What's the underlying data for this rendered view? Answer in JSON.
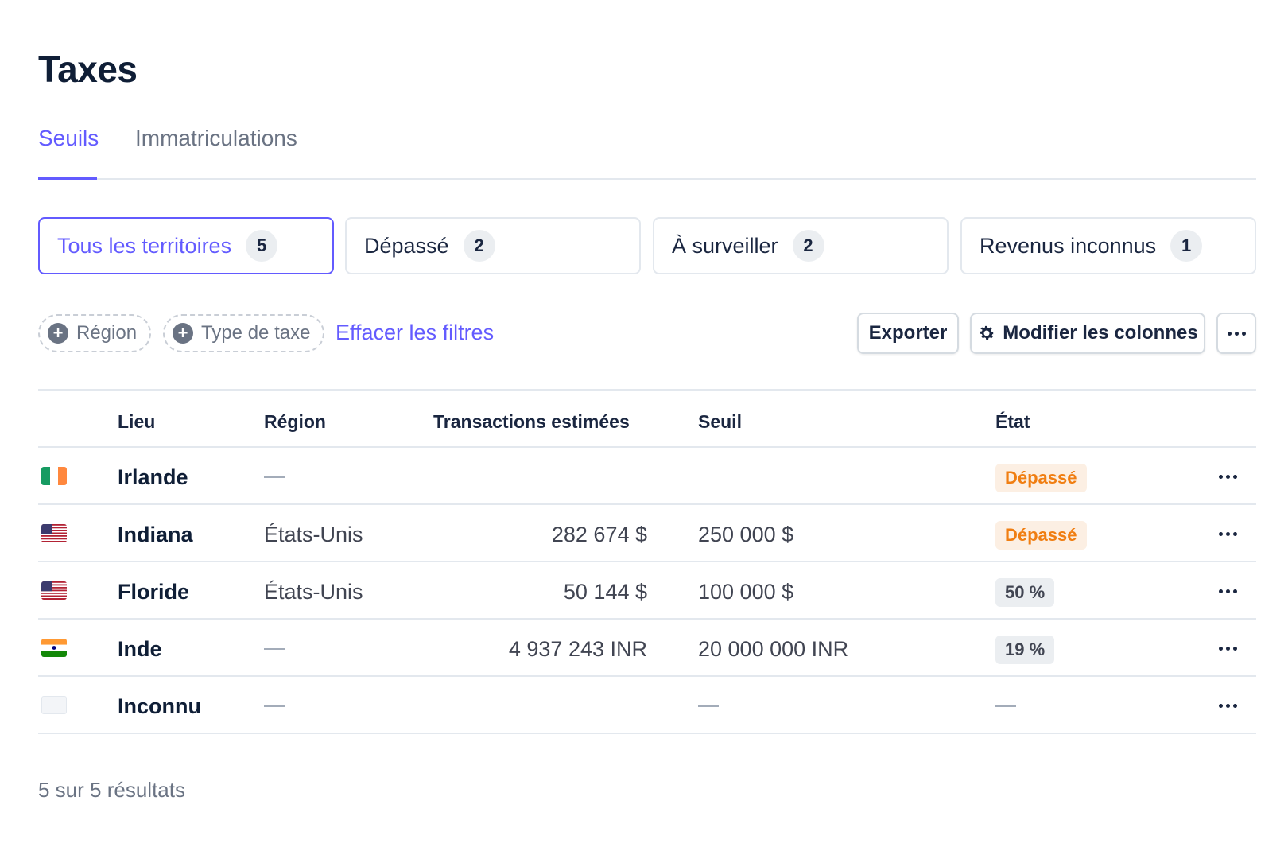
{
  "page": {
    "title": "Taxes"
  },
  "tabs": [
    {
      "label": "Seuils",
      "active": true
    },
    {
      "label": "Immatriculations",
      "active": false
    }
  ],
  "filter_cards": [
    {
      "label": "Tous les territoires",
      "count": "5",
      "selected": true
    },
    {
      "label": "Dépassé",
      "count": "2",
      "selected": false
    },
    {
      "label": "À surveiller",
      "count": "2",
      "selected": false
    },
    {
      "label": "Revenus inconnus",
      "count": "1",
      "selected": false
    }
  ],
  "filters": {
    "region_label": "Région",
    "tax_type_label": "Type de taxe",
    "clear_label": "Effacer les filtres"
  },
  "actions": {
    "export_label": "Exporter",
    "edit_columns_label": "Modifier les colonnes",
    "more_icon": "ellipsis-icon"
  },
  "table": {
    "columns": [
      "Lieu",
      "Région",
      "Transactions estimées",
      "Seuil",
      "État"
    ],
    "rows": [
      {
        "flag": "ireland-flag",
        "place": "Irlande",
        "region": "",
        "transactions": "",
        "threshold": "",
        "status": "Dépassé",
        "status_type": "over"
      },
      {
        "flag": "usa-flag",
        "place": "Indiana",
        "region": "États-Unis",
        "transactions": "282 674 $",
        "threshold": "250 000 $",
        "status": "Dépassé",
        "status_type": "over"
      },
      {
        "flag": "usa-flag",
        "place": "Floride",
        "region": "États-Unis",
        "transactions": "50 144 $",
        "threshold": "100 000 $",
        "status": "50 %",
        "status_type": "pct"
      },
      {
        "flag": "india-flag",
        "place": "Inde",
        "region": "",
        "transactions": "4 937 243 INR",
        "threshold": "20 000 000 INR",
        "status": "19 %",
        "status_type": "pct"
      },
      {
        "flag": "unknown-flag",
        "place": "Inconnu",
        "region": "",
        "transactions": "",
        "threshold": "",
        "status": "",
        "status_type": "none"
      }
    ]
  },
  "footer": {
    "results_text": "5 sur 5 résultats"
  },
  "colors": {
    "accent": "#635bff",
    "over_badge_bg": "#fcefe3",
    "over_badge_text": "#f07e12",
    "neutral_badge_bg": "#ebeef1"
  }
}
